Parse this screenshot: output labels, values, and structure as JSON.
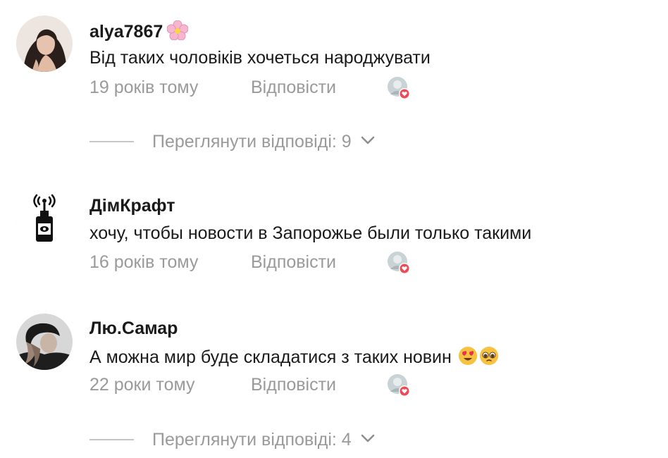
{
  "comments": [
    {
      "username": "alya7867",
      "username_badge": "cherry-blossom-emoji",
      "text": "Від таких чоловіків хочеться народжувати",
      "time": "19 років тому",
      "reply_label": "Відповісти",
      "liked_by_author": true,
      "view_replies": "Переглянути відповіді: 9"
    },
    {
      "username": "ДімКрафт",
      "text": "хочу, чтобы новости в Запорожье были только такими",
      "time": "16 років тому",
      "reply_label": "Відповісти",
      "liked_by_author": true
    },
    {
      "username": "Лю.Самар",
      "text": "А можна мир буде складатися з таких новин",
      "text_emojis": [
        "heart-eyes-emoji",
        "pleading-face-emoji"
      ],
      "time": "22 роки тому",
      "reply_label": "Відповісти",
      "liked_by_author": true,
      "view_replies": "Переглянути відповіді: 4"
    }
  ],
  "colors": {
    "primary_text": "#1a1a1a",
    "secondary_text": "#9a9a9a",
    "divider": "#c7c7c7",
    "like_heart": "#ed4956"
  }
}
